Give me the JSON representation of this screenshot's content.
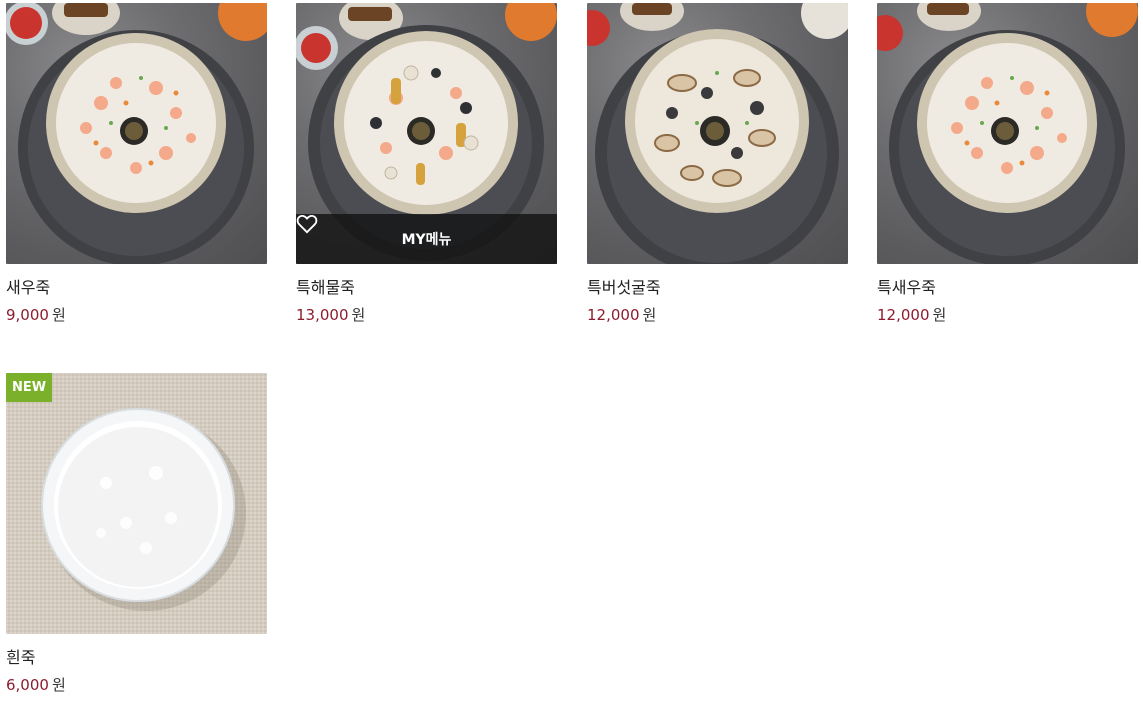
{
  "menu_items": [
    {
      "name": "새우죽",
      "price": "9,000",
      "currency": "원",
      "dish": "shrimp"
    },
    {
      "name": "특해물죽",
      "price": "13,000",
      "currency": "원",
      "dish": "seafood",
      "hover_label": "MY메뉴",
      "hover_icon": "heart-outline-icon"
    },
    {
      "name": "특버섯굴죽",
      "price": "12,000",
      "currency": "원",
      "dish": "mushroom-oyster"
    },
    {
      "name": "특새우죽",
      "price": "12,000",
      "currency": "원",
      "dish": "shrimp"
    },
    {
      "name": "흰죽",
      "price": "6,000",
      "currency": "원",
      "dish": "plain",
      "badge": "NEW"
    }
  ],
  "colors": {
    "price": "#8c1d2e",
    "badge": "#7bb12a",
    "overlay": "#141414"
  }
}
